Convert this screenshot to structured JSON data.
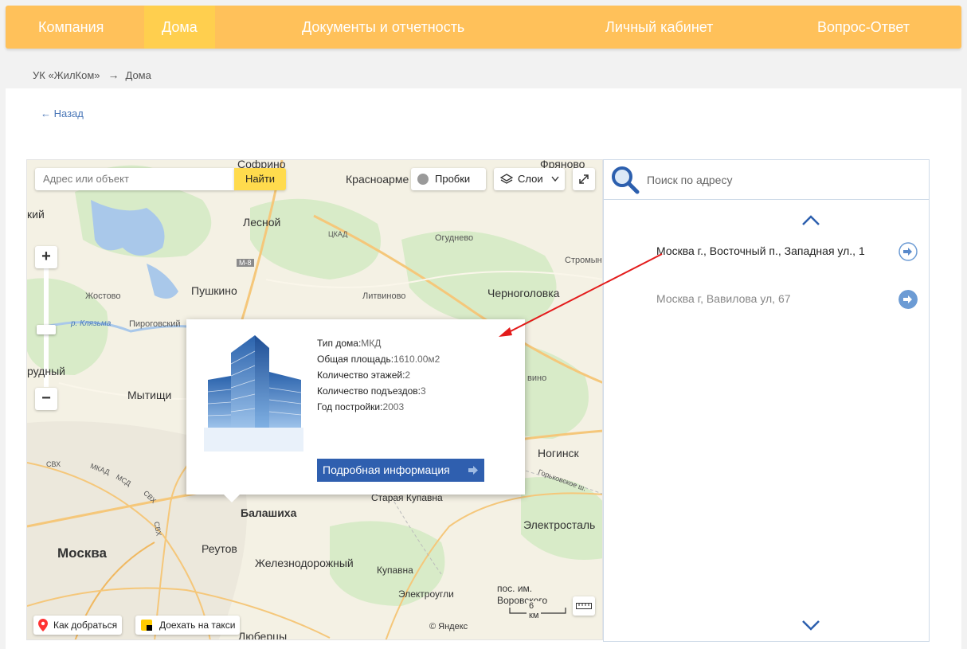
{
  "nav": {
    "items": [
      "Компания",
      "Дома",
      "Документы и отчетность",
      "Личный кабинет",
      "Вопрос-Ответ"
    ]
  },
  "breadcrumb": {
    "root": "УК «ЖилКом»",
    "sep": "→",
    "current": "Дома"
  },
  "back_link": "← Назад",
  "map": {
    "search_placeholder": "Адрес или объект",
    "find_label": "Найти",
    "traffic_label": "Пробки",
    "layers_label": "Слои",
    "route_label": "Как добраться",
    "taxi_label": "Доехать на такси",
    "copyright": "© Яндекс",
    "scale_label": "6 км",
    "places": {
      "sofrino": "Софрино",
      "fryanovo": "Фряново",
      "krasnoarm": "Красноарме",
      "kiy": "кий",
      "lesnoy": "Лесной",
      "tskad": "ЦКАД",
      "ogudnevo": "Огуднево",
      "m8": "М-8",
      "stromyn": "Стромын",
      "pushkino": "Пушкино",
      "chernogolovka": "Черноголовка",
      "zhostovo": "Жостово",
      "litvinovo": "Литвиново",
      "klyazma": "р. Клязьма",
      "pirogovsky": "Пироговский",
      "rudny": "рудный",
      "mytishchi": "Мытищи",
      "vino": "вино",
      "noginsk": "Ногинск",
      "svh1": "СВХ",
      "mkad": "МКАД",
      "msd": "МСД",
      "svh2": "СВХ",
      "svh3": "СВХ",
      "gorkovskoe": "Горьковское ш.",
      "staraya": "Старая Купавна",
      "balashikha": "Балашиха",
      "elektrostal": "Электросталь",
      "moskva": "Москва",
      "reutov": "Реутов",
      "zheleznodor": "Железнодорожный",
      "kupavna": "Купавна",
      "elektrougli": "Электроугли",
      "vorovsky1": "пос. им.",
      "vorovsky2": "Воровского",
      "lyubertsy": "Люберцы"
    }
  },
  "popup": {
    "props": [
      {
        "label": "Тип дома:",
        "value": "МКД"
      },
      {
        "label": "Общая площадь:",
        "value": "1610.00м2"
      },
      {
        "label": "Количество этажей:",
        "value": "2"
      },
      {
        "label": "Количество подъездов:",
        "value": "3"
      },
      {
        "label": "Год постройки:",
        "value": "2003"
      }
    ],
    "more_label": "Подробная информация"
  },
  "address_list": {
    "search_placeholder": "Поиск по адресу",
    "items": [
      "Москва г., Восточный п., Западная ул., 1",
      "Москва г, Вавилова ул, 67"
    ]
  },
  "colors": {
    "nav": "#ffc15a",
    "nav_active": "#ffcf4e",
    "accent_blue": "#2f5faf",
    "find_yellow": "#ffdb4d",
    "arrow_red": "#e31b1b"
  }
}
